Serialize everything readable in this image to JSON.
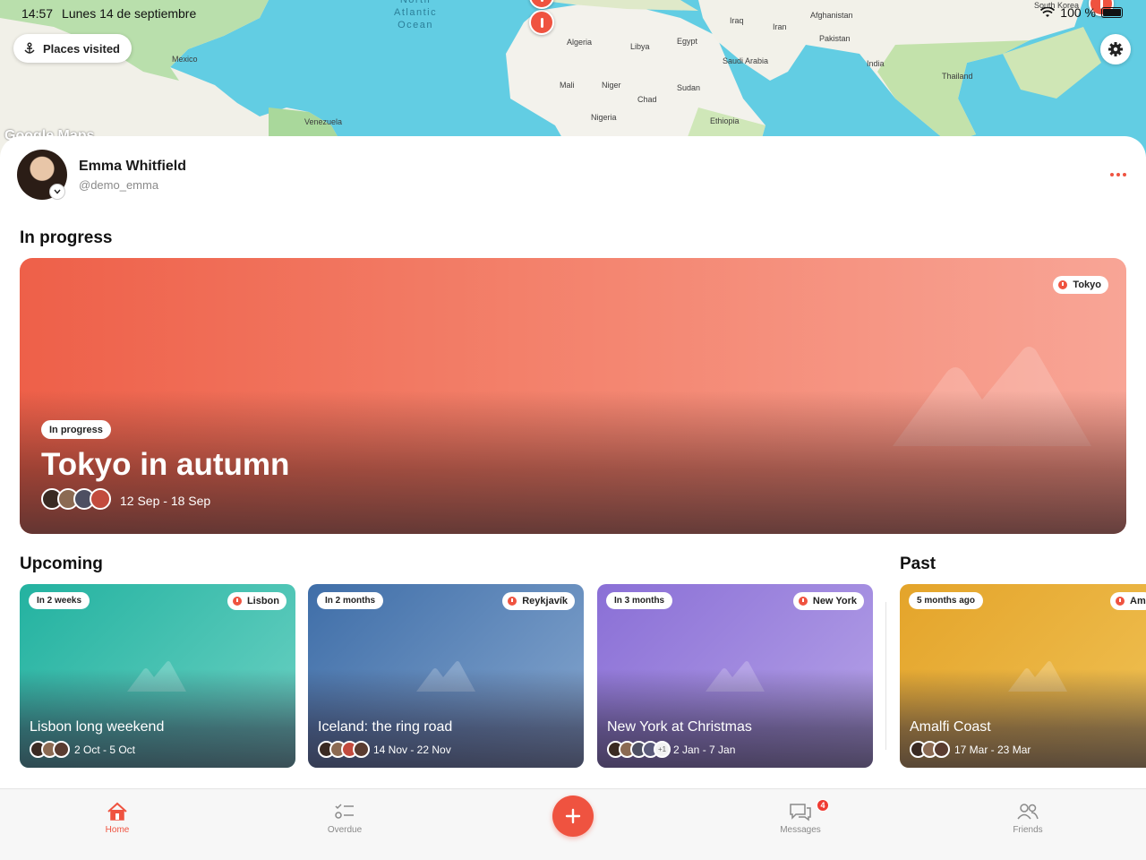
{
  "status_bar": {
    "time": "14:57",
    "date": "Lunes 14 de septiembre",
    "battery": "100 %"
  },
  "map": {
    "ocean_label": "North\nAtlantic\nOcean",
    "attribution": "Google Maps",
    "labels": [
      "Mexico",
      "Venezuela",
      "Algeria",
      "Libya",
      "Egypt",
      "Mali",
      "Niger",
      "Chad",
      "Sudan",
      "Nigeria",
      "Ethiopia",
      "Saudi Arabia",
      "Iraq",
      "Iran",
      "Afghanistan",
      "Pakistan",
      "India",
      "Thailand",
      "South Korea"
    ]
  },
  "places_button": {
    "label": "Places visited",
    "icon": "anchor-icon"
  },
  "settings_button": {
    "icon": "gear-icon"
  },
  "profile": {
    "name": "Emma Whitfield",
    "handle": "@demo_emma"
  },
  "sections": {
    "in_progress": "In progress",
    "upcoming": "Upcoming",
    "past": "Past"
  },
  "hero_trip": {
    "status": "In progress",
    "location": "Tokyo",
    "title": "Tokyo in autumn",
    "dates": "12 Sep - 18 Sep",
    "colors": [
      "#ee6049",
      "#f8a596"
    ]
  },
  "upcoming_trips": [
    {
      "status": "In 2 weeks",
      "location": "Lisbon",
      "title": "Lisbon long weekend",
      "dates": "2 Oct - 5 Oct",
      "colors": [
        "#23b2a0",
        "#6dd2c4"
      ]
    },
    {
      "status": "In 2 months",
      "location": "Reykjavík",
      "title": "Iceland: the ring road",
      "dates": "14 Nov - 22 Nov",
      "colors": [
        "#3f6ea8",
        "#86a7cf"
      ]
    },
    {
      "status": "In 3 months",
      "location": "New York",
      "title": "New York at Christmas",
      "dates": "2 Jan - 7 Jan",
      "extra_members": "+1",
      "colors": [
        "#8a6fd6",
        "#b6a3e8"
      ]
    }
  ],
  "past_trips": [
    {
      "status": "5 months ago",
      "location": "Am",
      "title": "Amalfi Coast",
      "dates": "17 Mar - 23 Mar",
      "colors": [
        "#e4a42a",
        "#f0c255"
      ]
    }
  ],
  "tabbar": {
    "home": "Home",
    "overdue": "Overdue",
    "messages": "Messages",
    "messages_badge": "4",
    "friends": "Friends",
    "accent": "#ef5340"
  }
}
